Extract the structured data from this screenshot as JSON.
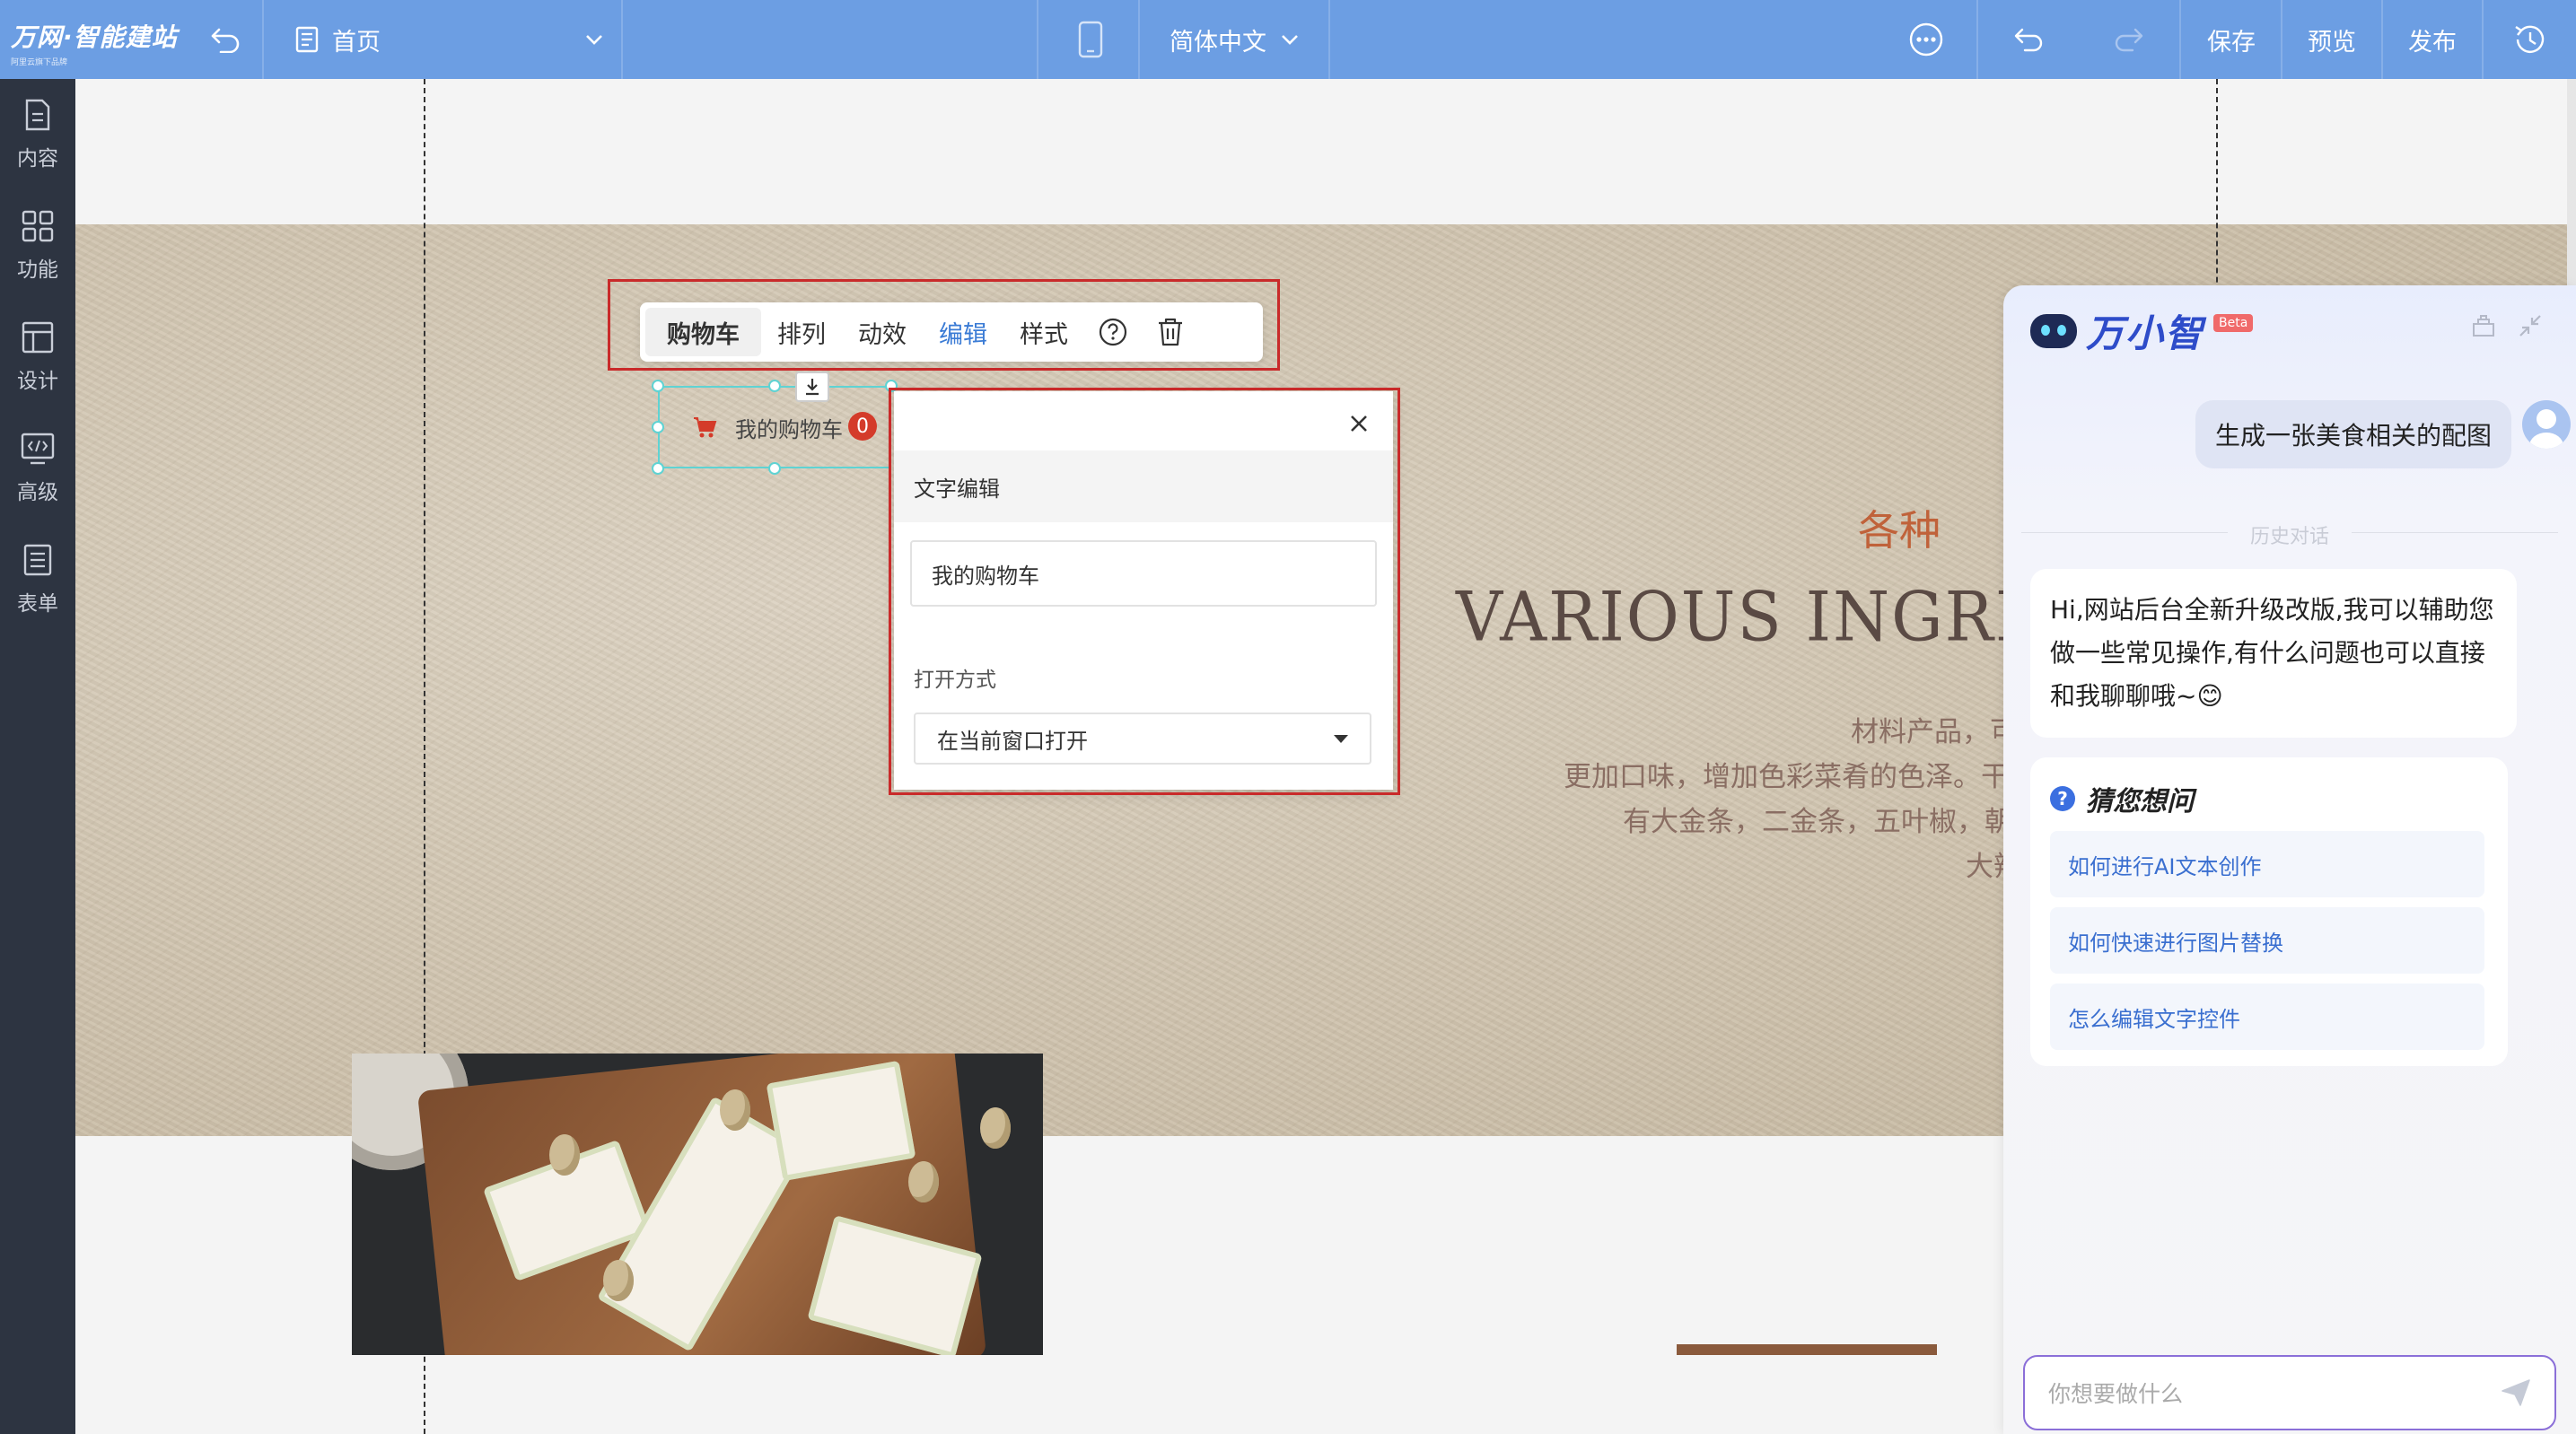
{
  "topbar": {
    "logo_main": "万网·智能建站",
    "logo_sub": "阿里云旗下品牌",
    "page_name": "首页",
    "language": "简体中文",
    "save": "保存",
    "preview": "预览",
    "publish": "发布"
  },
  "sidebar": {
    "items": [
      {
        "label": "内容",
        "icon": "document-icon"
      },
      {
        "label": "功能",
        "icon": "grid-icon"
      },
      {
        "label": "设计",
        "icon": "layout-icon"
      },
      {
        "label": "高级",
        "icon": "code-icon"
      },
      {
        "label": "表单",
        "icon": "form-icon"
      }
    ]
  },
  "banner": {
    "cn_title": "各种",
    "en_title": "VARIOUS INGRE",
    "lines": [
      "材料产品，可",
      "更加口味，增加色彩菜肴的色泽。干",
      "有大金条，二金条，五叶椒，朝",
      "大辣"
    ]
  },
  "toolbar": {
    "tabs": [
      "购物车",
      "排列",
      "动效",
      "编辑",
      "样式"
    ],
    "active_tab": "编辑"
  },
  "cart": {
    "label": "我的购物车",
    "count": "0"
  },
  "popup": {
    "section_title": "文字编辑",
    "text_value": "我的购物车",
    "open_label": "打开方式",
    "open_value": "在当前窗口打开"
  },
  "chat": {
    "brand": "万小智",
    "beta": "Beta",
    "user_message": "生成一张美食相关的配图",
    "history_label": "历史对话",
    "bot_message": "Hi,网站后台全新升级改版,我可以辅助您做一些常见操作,有什么问题也可以直接和我聊聊哦~😊",
    "guess_title": "猜您想问",
    "questions": [
      "如何进行AI文本创作",
      "如何快速进行图片替换",
      "怎么编辑文字控件"
    ],
    "input_placeholder": "你想要做什么"
  },
  "colors": {
    "topbar": "#6c9ee3",
    "sidebar": "#2d3441",
    "accent": "#3a7bd5",
    "highlight": "#c92a2a"
  }
}
